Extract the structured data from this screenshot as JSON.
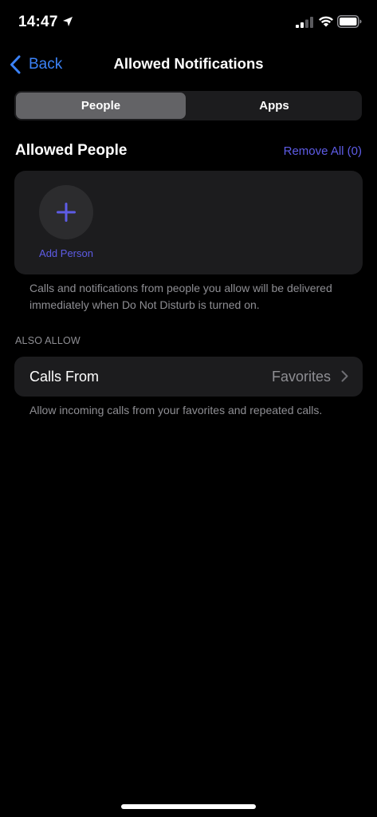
{
  "status_bar": {
    "time": "14:47",
    "icons": [
      "location-arrow-icon",
      "cellular-signal-icon",
      "wifi-icon",
      "battery-icon"
    ]
  },
  "nav": {
    "back_label": "Back",
    "title": "Allowed Notifications"
  },
  "segmented": {
    "selected": "People",
    "options": [
      "People",
      "Apps"
    ]
  },
  "allowed_people": {
    "heading": "Allowed People",
    "remove_all": "Remove All (0)",
    "add_person_label": "Add Person",
    "footnote": "Calls and notifications from people you allow will be delivered immediately when Do Not Disturb is turned on."
  },
  "also_allow": {
    "header": "ALSO ALLOW",
    "calls_from_label": "Calls From",
    "calls_from_value": "Favorites",
    "footnote": "Allow incoming calls from your favorites and repeated calls."
  },
  "colors": {
    "background": "#000000",
    "card": "#1c1c1e",
    "accent_blue": "#3b82f6",
    "accent_purple": "#5e5ce6",
    "secondary_text": "#8e8e93"
  }
}
